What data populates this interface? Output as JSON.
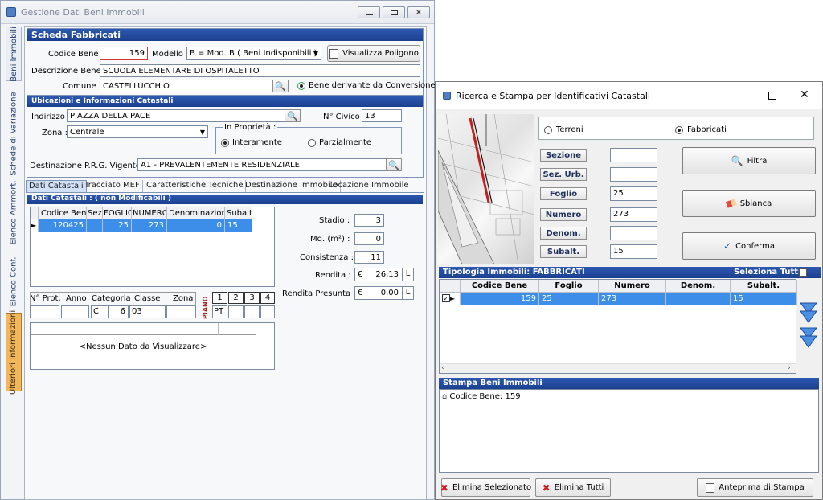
{
  "main_window": {
    "title": "Gestione Dati Beni Immobili",
    "side_tabs": [
      "Beni Immobili",
      "Schede di Variazione",
      "Elenco Ammort.",
      "Elenco Conf.",
      "Ulteriori Informazioni"
    ],
    "scheda": {
      "header": "Scheda Fabbricati",
      "codice_bene_label": "Codice Bene :",
      "codice_bene": "159",
      "modello_label": "Modello :",
      "modello": "B = Mod. B ( Beni Indisponibili )",
      "visualizza_btn": "Visualizza Poligono",
      "descrizione_label": "Descrizione Bene :",
      "descrizione": "SCUOLA ELEMENTARE DI OSPITALETTO",
      "comune_label": "Comune :",
      "comune": "CASTELLUCCHIO",
      "bene_derivante": "Bene derivante da Conversione"
    },
    "ubicazioni": {
      "header": "Ubicazioni e Informazioni Catastali",
      "indirizzo_label": "Indirizzo :",
      "indirizzo": "PIAZZA DELLA PACE",
      "civico_label": "N° Civico :",
      "civico": "13",
      "zona_label": "Zona :",
      "zona": "Centrale",
      "proprieta_label": "In Proprietà :",
      "interamente": "Interamente",
      "parzialmente": "Parzialmente",
      "destinazione_label": "Destinazione P.R.G. Vigente :",
      "destinazione": "A1 - PREVALENTEMENTE RESIDENZIALE"
    },
    "tabs": [
      "Dati Catastali",
      "Tracciato MEF",
      "Caratteristiche Tecniche",
      "Destinazione Immobile",
      "Locazione Immobile"
    ],
    "dati_catastali": {
      "header": "Dati Catastali : ( non Modificabili )",
      "columns": [
        "Codice Bene",
        "Sez.",
        "FOGLIO",
        "NUMERO",
        "Denominazione",
        "Subalt."
      ],
      "row": [
        "120425",
        "",
        "25",
        "273",
        "0",
        "15"
      ],
      "stadio_label": "Stadio :",
      "stadio": "3",
      "mq_label": "Mq. (m²) :",
      "mq": "0",
      "consistenza_label": "Consistenza :",
      "consistenza": "11",
      "rendita_label": "Rendita :",
      "rendita": "26,13",
      "rendita_presunta_label": "Rendita Presunta :",
      "rendita_presunta": "0,00",
      "currency": "€",
      "l_label": "L",
      "prot_columns": [
        "N° Prot.",
        "Anno",
        "Categoria",
        "Classe",
        "Zona"
      ],
      "piano_label": "PIANO",
      "piano_numbers": [
        "1",
        "2",
        "3",
        "4"
      ],
      "categoria_a": "C",
      "categoria_b": "6",
      "classe": "03",
      "piano": "PT",
      "empty_text": "<Nessun Dato da Visualizzare>"
    }
  },
  "search_window": {
    "title": "Ricerca e Stampa per Identificativi Catastali",
    "terreni": "Terreni",
    "fabbricati": "Fabbricati",
    "sezione_label": "Sezione",
    "sez_urb_label": "Sez. Urb.",
    "foglio_label": "Foglio",
    "foglio": "25",
    "numero_label": "Numero",
    "numero": "273",
    "denom_label": "Denom.",
    "subalt_label": "Subalt.",
    "subalt": "15",
    "filtra_btn": "Filtra",
    "sbianca_btn": "Sbianca",
    "conferma_btn": "Conferma",
    "tipologia_header": "Tipologia Immobili: FABBRICATI",
    "seleziona_tutti": "Seleziona Tutti",
    "columns": [
      "Codice Bene",
      "Foglio",
      "Numero",
      "Denom.",
      "Subalt."
    ],
    "row": [
      "159",
      "25",
      "273",
      "",
      "15"
    ],
    "stampa_header": "Stampa Beni Immobili",
    "stampa_item": "Codice Bene: 159",
    "elimina_sel_btn": "Elimina Selezionato",
    "elimina_tutti_btn": "Elimina Tutti",
    "anteprima_btn": "Anteprima di Stampa"
  },
  "colors": {
    "accent": "#1e4596",
    "selection": "#3d8ee8",
    "codice_border": "#d23a3a"
  }
}
